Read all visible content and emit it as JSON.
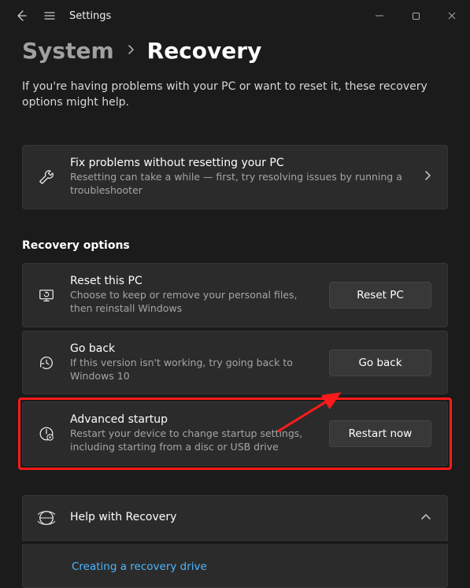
{
  "titlebar": {
    "title": "Settings"
  },
  "breadcrumb": {
    "system": "System",
    "current": "Recovery"
  },
  "intro": "If you're having problems with your PC or want to reset it, these recovery options might help.",
  "fix": {
    "title": "Fix problems without resetting your PC",
    "sub": "Resetting can take a while — first, try resolving issues by running a troubleshooter"
  },
  "section": "Recovery options",
  "reset": {
    "title": "Reset this PC",
    "sub": "Choose to keep or remove your personal files, then reinstall Windows",
    "button": "Reset PC"
  },
  "goback": {
    "title": "Go back",
    "sub": "If this version isn't working, try going back to Windows 10",
    "button": "Go back"
  },
  "advanced": {
    "title": "Advanced startup",
    "sub": "Restart your device to change startup settings, including starting from a disc or USB drive",
    "button": "Restart now"
  },
  "help": {
    "title": "Help with Recovery",
    "link1": "Creating a recovery drive"
  }
}
